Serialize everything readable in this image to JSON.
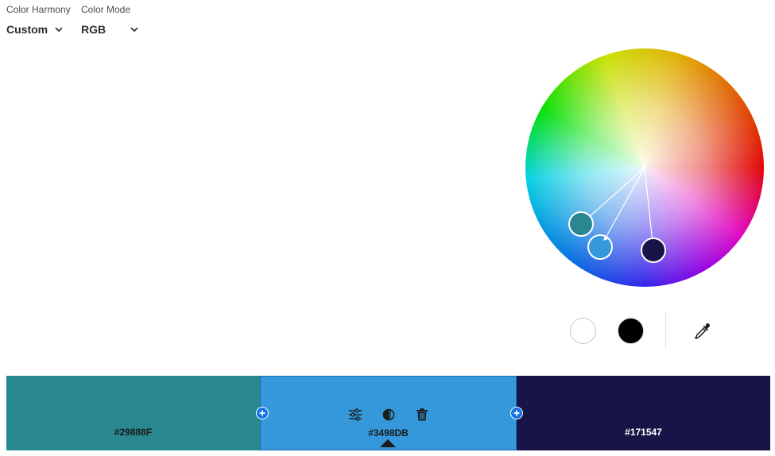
{
  "header": {
    "harmony_label": "Color Harmony",
    "harmony_value": "Custom",
    "mode_label": "Color Mode",
    "mode_value": "RGB"
  },
  "wheel": {
    "handles": [
      {
        "name": "handle-1",
        "color": "#29888F"
      },
      {
        "name": "handle-2",
        "color": "#3498DB",
        "selected": true
      },
      {
        "name": "handle-3",
        "color": "#171547"
      }
    ]
  },
  "quick_colors": {
    "white": "#FFFFFF",
    "black": "#000000"
  },
  "swatches": [
    {
      "hex": "#29888F",
      "color": "#29888F",
      "text_color": "#1a1a1a"
    },
    {
      "hex": "#3498DB",
      "color": "#3498DB",
      "text_color": "#1a1a1a",
      "selected": true
    },
    {
      "hex": "#171547",
      "color": "#171547",
      "text_color": "#ffffff"
    }
  ],
  "icons": {
    "adjust": "sliders-icon",
    "shade": "contrast-icon",
    "delete": "trash-icon",
    "add": "plus-icon",
    "eyedropper": "eyedropper-icon"
  },
  "accent": "#1473E6"
}
